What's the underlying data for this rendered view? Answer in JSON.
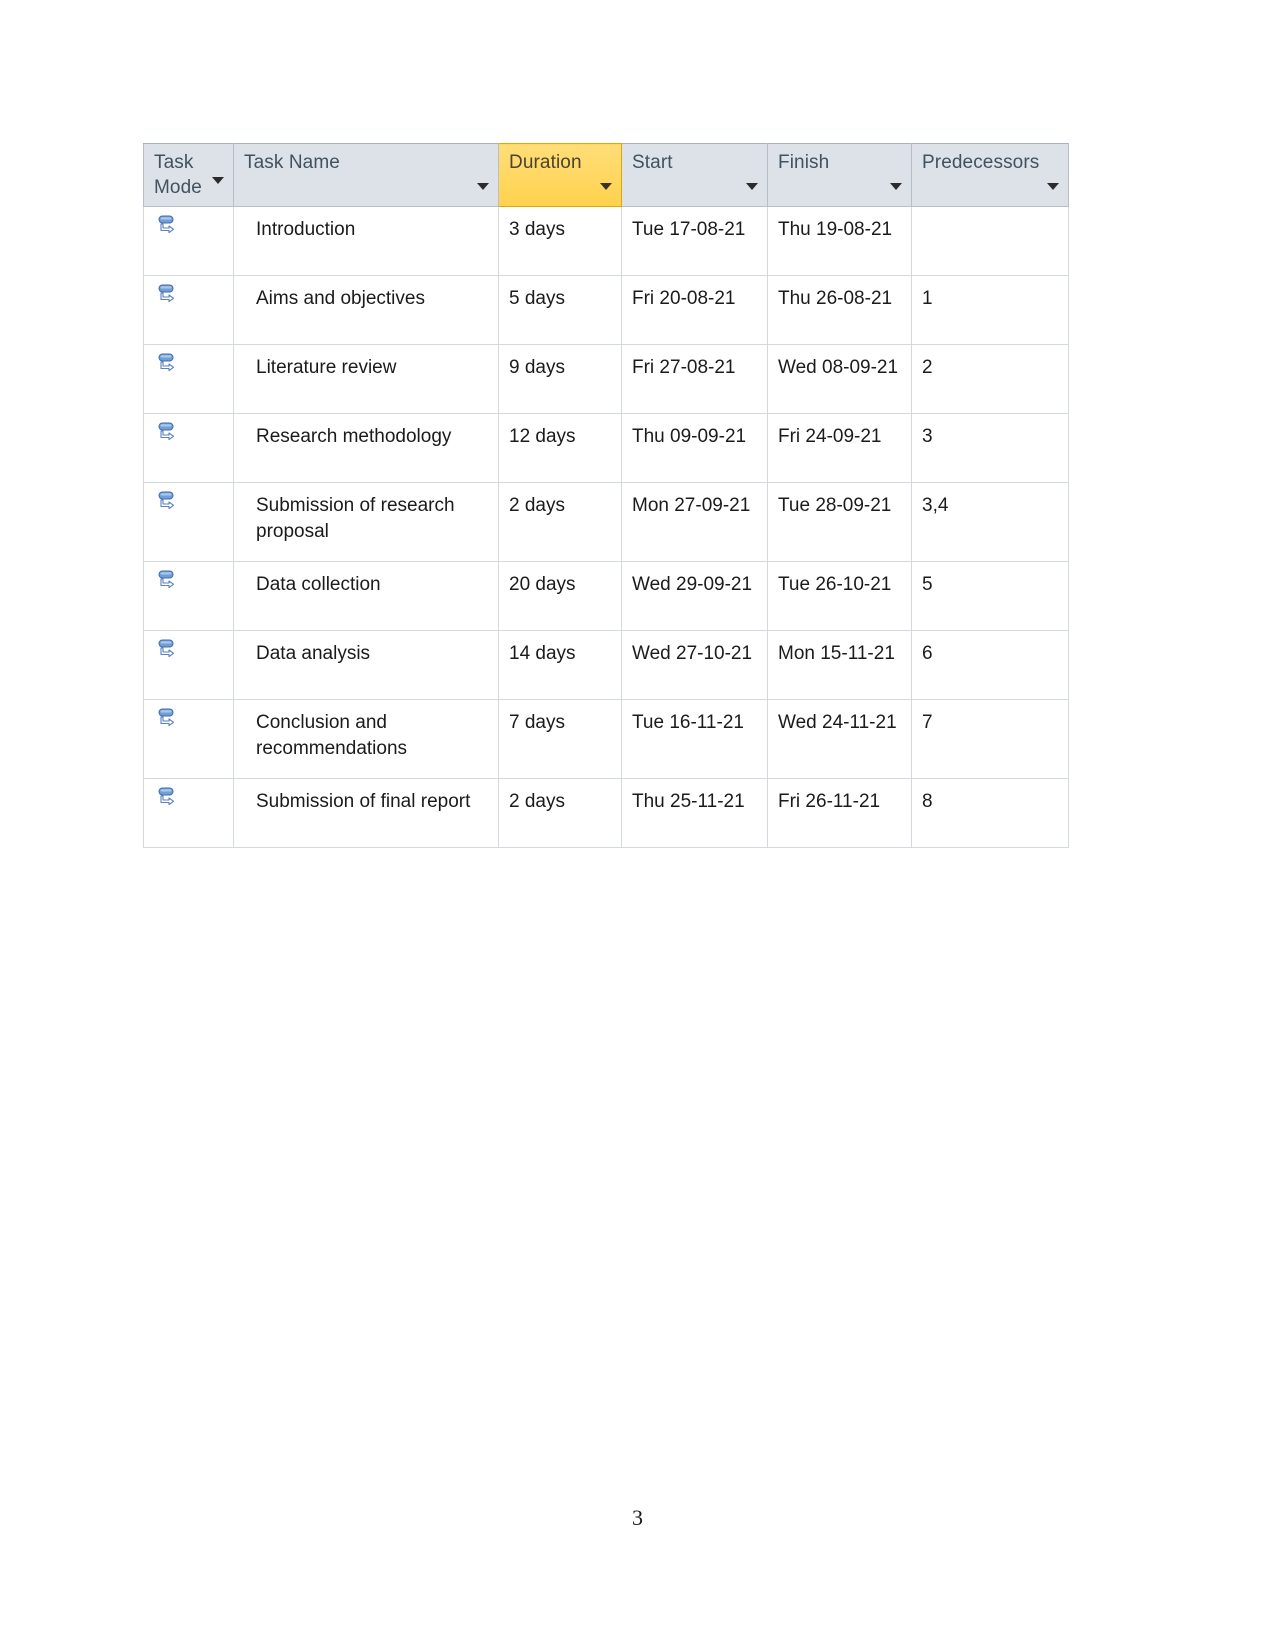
{
  "document": {
    "page_number": "3"
  },
  "table": {
    "name": "project-schedule-table",
    "accent_colors": {
      "header_background": "#dde2e8",
      "header_text": "#41525f",
      "duration_highlight": "#ffd966",
      "grid_line": "#d4d9de",
      "task_mode_icon": "#5b8ac6"
    },
    "columns": [
      {
        "key": "task_mode",
        "label": "Task\nMode",
        "label_line1": "Task",
        "label_line2": "Mode",
        "has_filter_arrow": true,
        "highlighted": false
      },
      {
        "key": "task_name",
        "label": "Task Name",
        "has_filter_arrow": true,
        "highlighted": false
      },
      {
        "key": "duration",
        "label": "Duration",
        "has_filter_arrow": true,
        "highlighted": true
      },
      {
        "key": "start",
        "label": "Start",
        "has_filter_arrow": true,
        "highlighted": false
      },
      {
        "key": "finish",
        "label": "Finish",
        "has_filter_arrow": true,
        "highlighted": false
      },
      {
        "key": "predecessors",
        "label": "Predecessors",
        "has_filter_arrow": true,
        "highlighted": false
      }
    ],
    "rows": [
      {
        "task_mode_icon": "auto-scheduled-icon",
        "task_name": "Introduction",
        "duration": "3 days",
        "start": "Tue 17-08-21",
        "finish": "Thu 19-08-21",
        "predecessors": "",
        "two_line": false
      },
      {
        "task_mode_icon": "auto-scheduled-icon",
        "task_name": "Aims and objectives",
        "duration": "5 days",
        "start": "Fri 20-08-21",
        "finish": "Thu 26-08-21",
        "predecessors": "1",
        "two_line": false
      },
      {
        "task_mode_icon": "auto-scheduled-icon",
        "task_name": "Literature review",
        "duration": "9 days",
        "start": "Fri 27-08-21",
        "finish": "Wed 08-09-21",
        "predecessors": "2",
        "two_line": false
      },
      {
        "task_mode_icon": "auto-scheduled-icon",
        "task_name": "Research methodology",
        "duration": "12 days",
        "start": "Thu 09-09-21",
        "finish": "Fri 24-09-21",
        "predecessors": "3",
        "two_line": false
      },
      {
        "task_mode_icon": "auto-scheduled-icon",
        "task_name": "Submission of research proposal",
        "duration": "2 days",
        "start": "Mon 27-09-21",
        "finish": "Tue 28-09-21",
        "predecessors": "3,4",
        "two_line": true
      },
      {
        "task_mode_icon": "auto-scheduled-icon",
        "task_name": "Data collection",
        "duration": "20 days",
        "start": "Wed 29-09-21",
        "finish": "Tue 26-10-21",
        "predecessors": "5",
        "two_line": false
      },
      {
        "task_mode_icon": "auto-scheduled-icon",
        "task_name": "Data analysis",
        "duration": "14 days",
        "start": "Wed 27-10-21",
        "finish": "Mon 15-11-21",
        "predecessors": "6",
        "two_line": false
      },
      {
        "task_mode_icon": "auto-scheduled-icon",
        "task_name": "Conclusion and recommendations",
        "duration": "7 days",
        "start": "Tue 16-11-21",
        "finish": "Wed 24-11-21",
        "predecessors": "7",
        "two_line": true
      },
      {
        "task_mode_icon": "auto-scheduled-icon",
        "task_name": "Submission of final report",
        "duration": "2 days",
        "start": "Thu 25-11-21",
        "finish": "Fri 26-11-21",
        "predecessors": "8",
        "two_line": false
      }
    ]
  }
}
